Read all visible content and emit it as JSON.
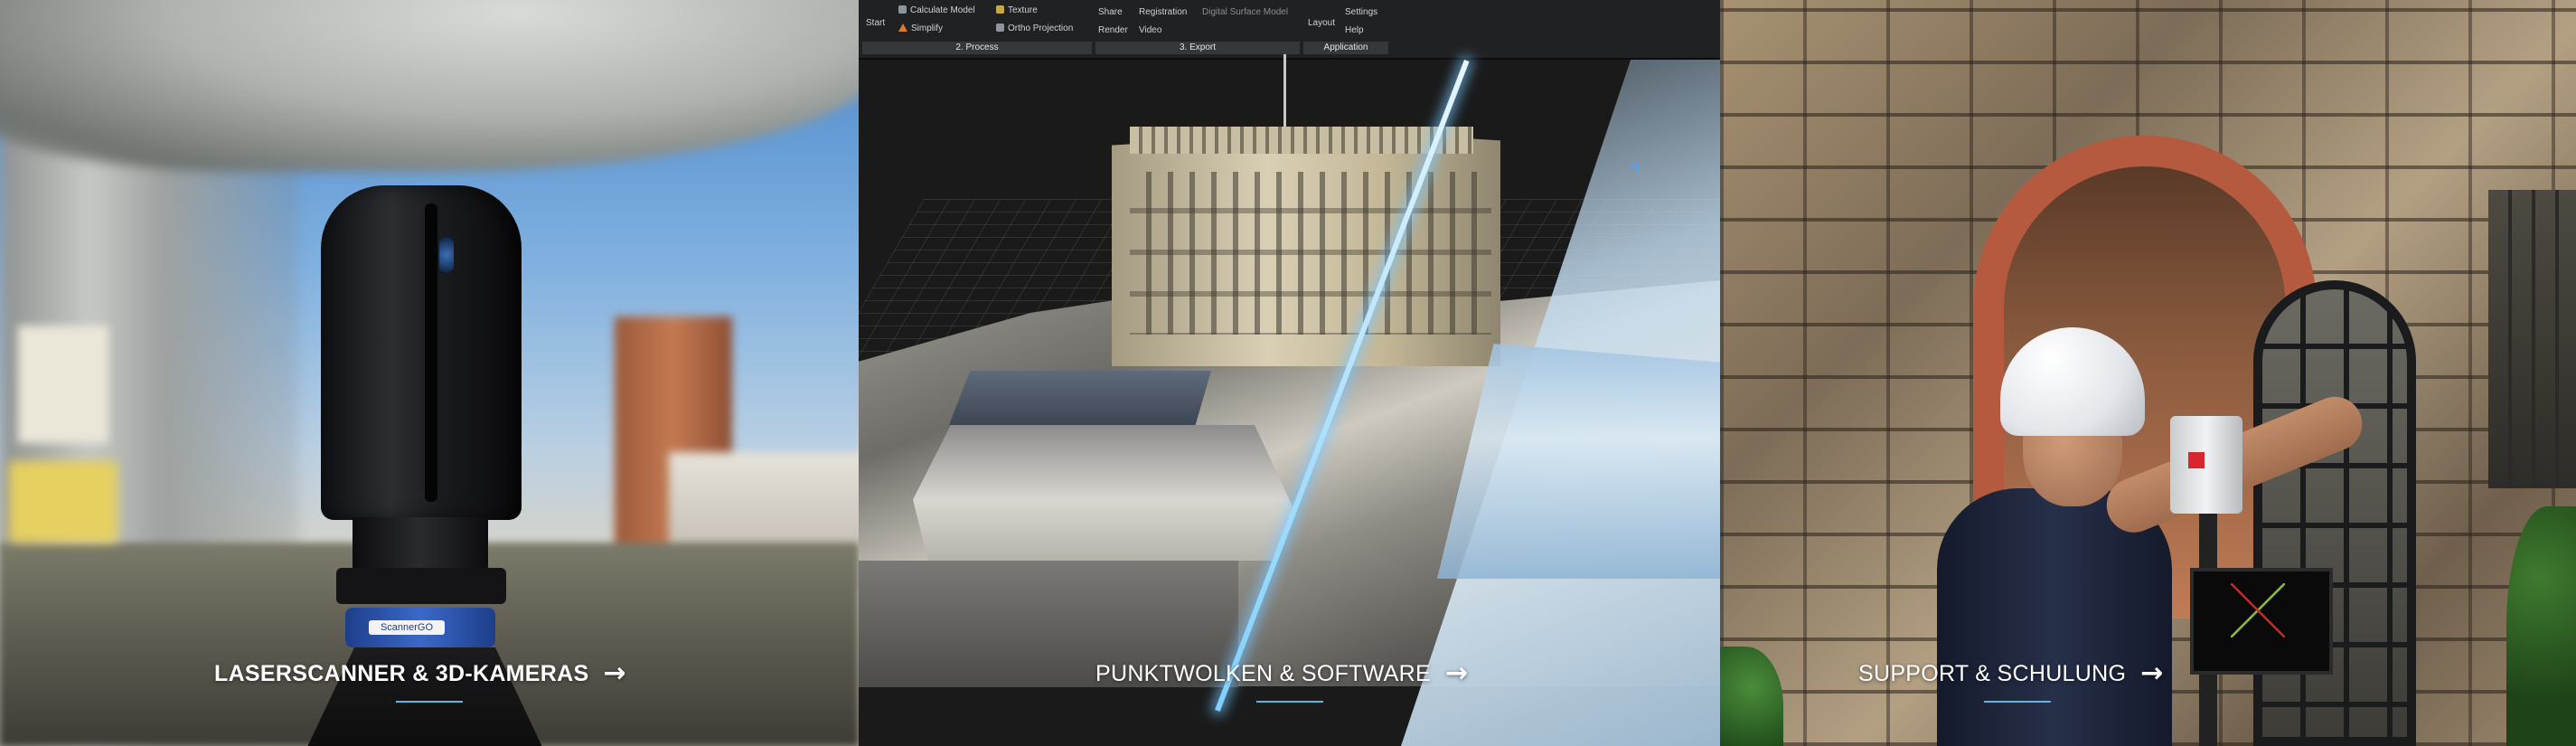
{
  "panels": [
    {
      "id": "laserscanner",
      "label": "LASERSCANNER & 3D-KAMERAS",
      "arrow": "→",
      "scanner_logo": "ScannerGO"
    },
    {
      "id": "punktwolken",
      "label": "PUNKTWOLKEN & SOFTWARE",
      "arrow": "→",
      "ribbon": {
        "start": "Start",
        "calculate_model": "Calculate Model",
        "simplify": "Simplify",
        "texture": "Texture",
        "ortho_projection": "Ortho Projection",
        "share": "Share",
        "registration": "Registration",
        "digital_surface_model": "Digital Surface Model",
        "render": "Render",
        "video": "Video",
        "layout": "Layout",
        "settings": "Settings",
        "help": "Help",
        "groups": [
          "2. Process",
          "3. Export",
          "Application"
        ]
      }
    },
    {
      "id": "support",
      "label": "SUPPORT & SCHULUNG",
      "arrow": "→"
    }
  ],
  "colors": {
    "accent_underline": "#5fb4e8",
    "label_text": "#ffffff",
    "scan_line": "#7fd0ff",
    "brick": "#b55a3e"
  }
}
